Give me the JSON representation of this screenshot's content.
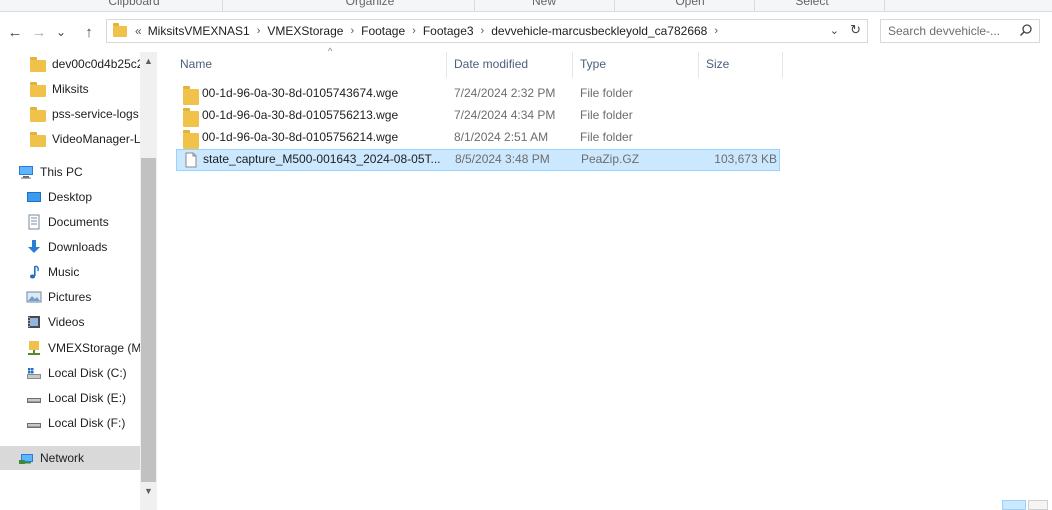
{
  "ribbon": {
    "groups": [
      "Clipboard",
      "Organize",
      "New",
      "Open",
      "Select"
    ]
  },
  "nav": {
    "back": "←",
    "forward": "→",
    "recent": "⌄",
    "up": "↑"
  },
  "address": {
    "overflow": "«",
    "crumbs": [
      "MiksitsVMEXNAS1",
      "VMEXStorage",
      "Footage",
      "Footage3",
      "devvehicle-marcusbeckleyold_ca782668"
    ],
    "dropdown": "⌄",
    "refresh": "↻"
  },
  "search": {
    "placeholder": "Search devvehicle-..."
  },
  "sidebar": {
    "items": [
      {
        "label": "dev00c0d4b25c2",
        "icon": "folder-icon"
      },
      {
        "label": "Miksits",
        "icon": "folder-icon"
      },
      {
        "label": "pss-service-logs",
        "icon": "folder-icon"
      },
      {
        "label": "VideoManager-L",
        "icon": "folder-icon"
      },
      {
        "label": "This PC",
        "icon": "computer-icon"
      },
      {
        "label": "Desktop",
        "icon": "desktop-icon"
      },
      {
        "label": "Documents",
        "icon": "documents-icon"
      },
      {
        "label": "Downloads",
        "icon": "downloads-icon"
      },
      {
        "label": "Music",
        "icon": "music-icon"
      },
      {
        "label": "Pictures",
        "icon": "pictures-icon"
      },
      {
        "label": "Videos",
        "icon": "videos-icon"
      },
      {
        "label": "VMEXStorage (M",
        "icon": "network-drive-icon"
      },
      {
        "label": "Local Disk (C:)",
        "icon": "system-drive-icon"
      },
      {
        "label": "Local Disk (E:)",
        "icon": "drive-icon"
      },
      {
        "label": "Local Disk (F:)",
        "icon": "drive-icon"
      },
      {
        "label": "Network",
        "icon": "network-icon"
      }
    ]
  },
  "columns": {
    "name": "Name",
    "date": "Date modified",
    "type": "Type",
    "size": "Size"
  },
  "files": [
    {
      "name": "00-1d-96-0a-30-8d-0105743674.wge",
      "date": "7/24/2024 2:32 PM",
      "type": "File folder",
      "size": "",
      "icon": "folder-icon"
    },
    {
      "name": "00-1d-96-0a-30-8d-0105756213.wge",
      "date": "7/24/2024 4:34 PM",
      "type": "File folder",
      "size": "",
      "icon": "folder-icon"
    },
    {
      "name": "00-1d-96-0a-30-8d-0105756214.wge",
      "date": "8/1/2024 2:51 AM",
      "type": "File folder",
      "size": "",
      "icon": "folder-icon"
    },
    {
      "name": "state_capture_M500-001643_2024-08-05T...",
      "date": "8/5/2024 3:48 PM",
      "type": "PeaZip.GZ",
      "size": "103,673 KB",
      "icon": "file-icon"
    }
  ],
  "colors": {
    "folder": "#f0c24a",
    "selection": "#cce8ff",
    "selection_border": "#99d1ff",
    "nav_selected": "#d9d9d9",
    "header_text": "#4c607a"
  }
}
